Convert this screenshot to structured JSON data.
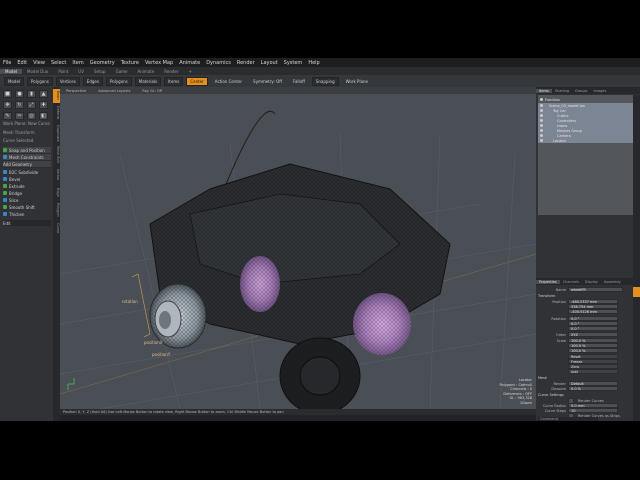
{
  "menubar": [
    "File",
    "Edit",
    "View",
    "Select",
    "Item",
    "Geometry",
    "Texture",
    "Vertex Map",
    "Animate",
    "Dynamics",
    "Render",
    "Layout",
    "System",
    "Help"
  ],
  "layout_tabs": {
    "active": "Model",
    "others": [
      "Model Duo",
      "Paint",
      "UV",
      "Setup",
      "Game",
      "Animate",
      "Render",
      "+"
    ]
  },
  "toolbar": {
    "items": [
      "Model",
      "Polygons",
      "Vertices",
      "Edges",
      "Polygons",
      "Materials",
      "Items",
      "Center",
      "Action Center",
      "Symmetry: Off",
      "Falloff",
      "Snapping",
      "Work Plane"
    ],
    "active_index": 7
  },
  "left_panel": {
    "vertical_tabs": [
      "Basic",
      "Deform",
      "Duplicate",
      "Mesh Edit",
      "Vertex",
      "Edge",
      "Polygon",
      "Curve"
    ],
    "active_tab": "Basic",
    "work_plane": "Work Plane: New Curve",
    "section": "Mesh Transform",
    "curve_section": "Curve Selected",
    "buttons": [
      "Snap and Position",
      "Mesh Constraints",
      "Add Geometry"
    ],
    "tools": [
      {
        "label": "B2C Subdivide",
        "color": "#3a86c8"
      },
      {
        "label": "Bevel",
        "color": "#3a86c8"
      },
      {
        "label": "Extrude",
        "color": "#4aa34a"
      },
      {
        "label": "Bridge",
        "color": "#4aa34a"
      },
      {
        "label": "Slice",
        "color": "#3a86c8"
      },
      {
        "label": "Smooth Shift",
        "color": "#4aa34a"
      },
      {
        "label": "Thicken",
        "color": "#3a86c8"
      }
    ],
    "dropdown": "Edit"
  },
  "viewport": {
    "header": [
      "Perspective",
      "Advanced Layouts",
      "Ray GL: Off"
    ],
    "labels": [
      "rotation",
      "positionX",
      "positionY"
    ],
    "info": [
      "Locator",
      "Polygons : Catmull",
      "Channels : 0",
      "Deformers : OFF",
      "GL : 963,328",
      "1Down"
    ]
  },
  "statusbar": "Position X, Y, Z  (Hold Alt) Use Left Mouse Button to rotate view, Right Mouse Button to zoom, Ctrl Middle Mouse Button to pan",
  "right_panel": {
    "tabs": [
      "Items",
      "Shading",
      "Groups",
      "Images"
    ],
    "active_tab": "Items",
    "items": [
      {
        "label": "Function",
        "indent": 0,
        "sel": false
      },
      {
        "label": "Scene_09_model.lxo",
        "indent": 1,
        "sel": true
      },
      {
        "label": "Toy Car",
        "indent": 2,
        "sel": true
      },
      {
        "label": "Cuters",
        "indent": 3,
        "sel": true
      },
      {
        "label": "Controllers",
        "indent": 3,
        "sel": true
      },
      {
        "label": "cubes",
        "indent": 3,
        "sel": true
      },
      {
        "label": "Meshes Group",
        "indent": 3,
        "sel": true
      },
      {
        "label": "Camera",
        "indent": 3,
        "sel": true
      },
      {
        "label": "Locator",
        "indent": 2,
        "sel": true
      }
    ],
    "props_tabs": [
      "Properties",
      "Channels",
      "Display",
      "Assembly"
    ],
    "props": {
      "name_label": "Name",
      "name": "wheelFR",
      "transform_label": "Transform",
      "position_label": "Position",
      "position": [
        "-480.2337 mm",
        "338.754 mm",
        "-400.5126 mm"
      ],
      "rotation_label": "Rotation",
      "rotation": [
        "0.0 °",
        "0.0 °",
        "0.0 °"
      ],
      "order_label": "Order",
      "order": "XYZ",
      "scale_label": "Scale",
      "scale": [
        "100.0 %",
        "100.0 %",
        "100.0 %"
      ],
      "reset_buttons": [
        "Reset",
        "Freeze",
        "Zero",
        "Add"
      ],
      "mesh_label": "Mesh",
      "render_label": "Render",
      "render": "Default",
      "dissolve_label": "Dissolve",
      "dissolve": "0.0 %",
      "curve_settings": "Curve Settings",
      "render_curves": "Render Curves",
      "curve_radius_label": "Curve Radius",
      "curve_radius": "5.0 mm",
      "curve_steps_label": "Curve Steps",
      "curve_steps": "10",
      "render_curve_as_strip": "Render Curves as Strips",
      "command": "Command"
    }
  },
  "colors": {
    "accent": "#e58f1c",
    "viewport_bg": "#4a4e55",
    "highlight_sphere": "#c98be0"
  }
}
